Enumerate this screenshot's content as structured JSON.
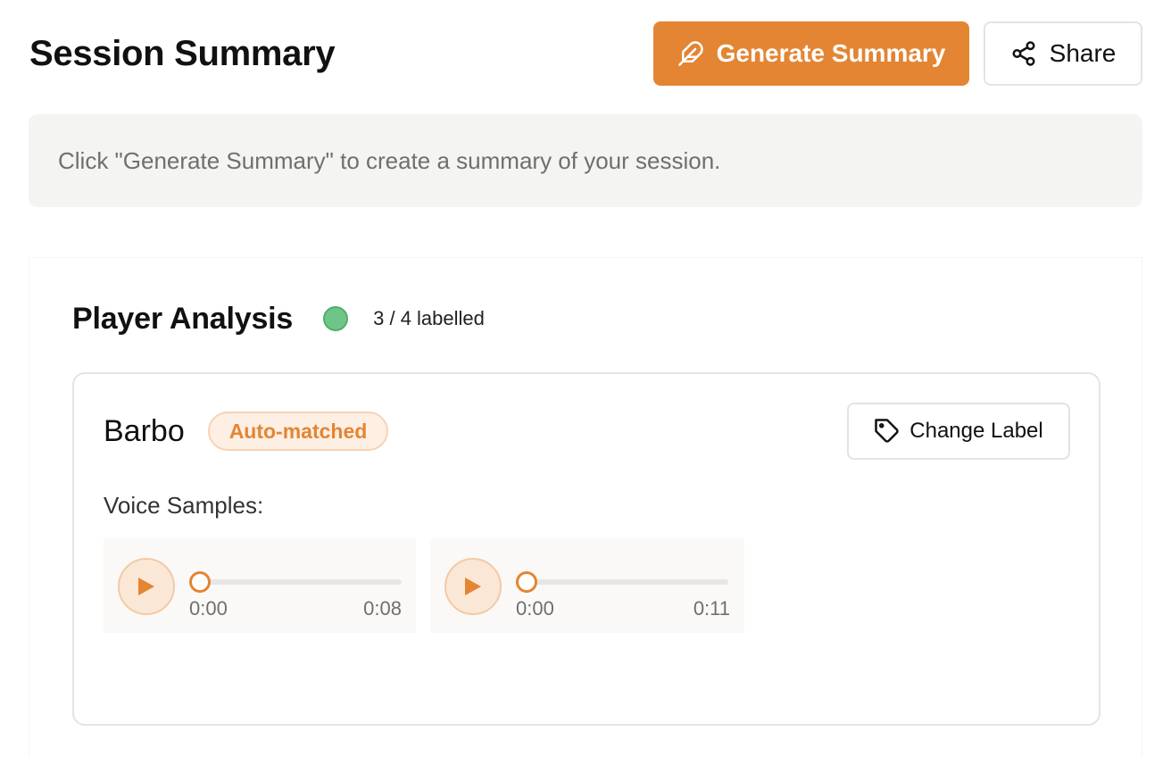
{
  "header": {
    "title": "Session Summary",
    "generate_label": "Generate Summary",
    "generate_icon": "feather-icon",
    "share_label": "Share",
    "share_icon": "share-icon"
  },
  "info": {
    "message": "Click \"Generate Summary\" to create a summary of your session."
  },
  "analysis": {
    "title": "Player Analysis",
    "status_color": "#6fc487",
    "status_text": "3 / 4 labelled"
  },
  "player": {
    "name": "Barbo",
    "badge": "Auto-matched",
    "change_label": "Change Label",
    "change_icon": "tag-icon",
    "samples_label": "Voice Samples:",
    "samples": [
      {
        "current": "0:00",
        "duration": "0:08",
        "progress": 0
      },
      {
        "current": "0:00",
        "duration": "0:11",
        "progress": 0
      }
    ]
  },
  "colors": {
    "accent": "#e38533",
    "badge_bg": "#fdefe3",
    "banner_bg": "#f4f4f2"
  }
}
